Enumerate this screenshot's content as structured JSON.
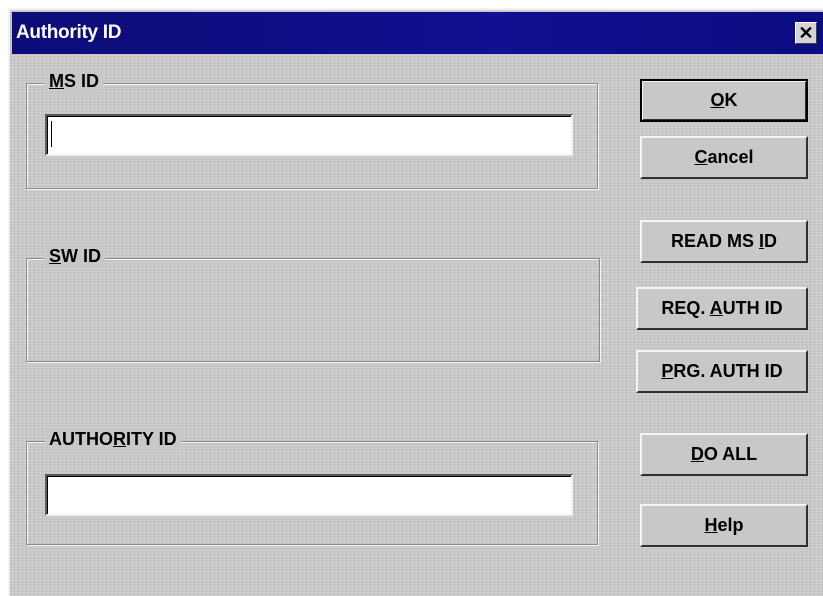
{
  "window": {
    "title": "Authority ID",
    "close_glyph": "✕"
  },
  "groups": {
    "ms_id": {
      "label_pre": "",
      "label_key": "M",
      "label_post": "S ID",
      "value": ""
    },
    "sw_id": {
      "label_pre": "",
      "label_key": "S",
      "label_post": "W ID"
    },
    "authority_id": {
      "label_pre": "AUTHO",
      "label_key": "R",
      "label_post": "ITY ID",
      "value": ""
    }
  },
  "buttons": {
    "ok": {
      "pre": "",
      "key": "O",
      "post": "K"
    },
    "cancel": {
      "pre": "",
      "key": "C",
      "post": "ancel"
    },
    "read_ms_id": {
      "pre": "READ MS ",
      "key": "I",
      "post": "D"
    },
    "req_auth_id": {
      "pre": "REQ. ",
      "key": "A",
      "post": "UTH ID"
    },
    "prg_auth_id": {
      "pre": "",
      "key": "P",
      "post": "RG. AUTH ID"
    },
    "do_all": {
      "pre": "",
      "key": "D",
      "post": "O ALL"
    },
    "help": {
      "pre": "",
      "key": "H",
      "post": "elp"
    }
  },
  "colors": {
    "titlebar": "#0c0c78",
    "dialog_bg": "#c8c8c8"
  }
}
